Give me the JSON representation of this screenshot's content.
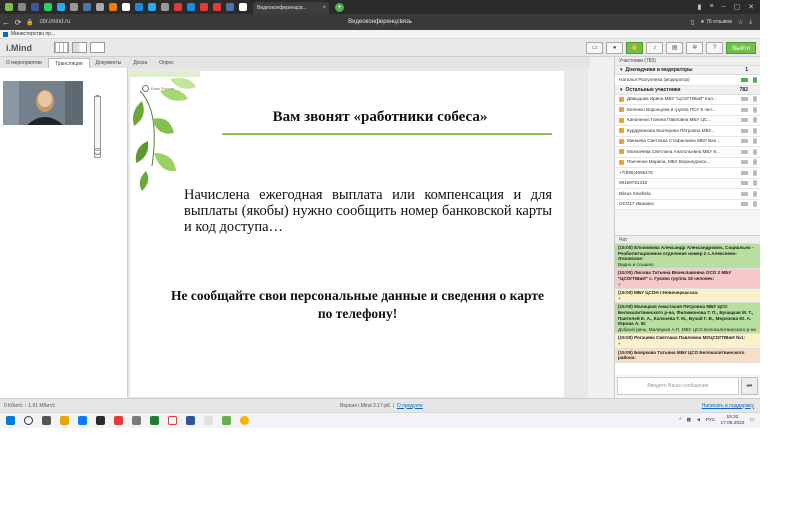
{
  "browser": {
    "active_tab_title": "Видеоконференцсв...",
    "url": "cbr.imind.ru",
    "page_title": "Видеоконференцсвязь",
    "reviews": "★ 76 отзывов",
    "bookmark": "Министерство пр..."
  },
  "app": {
    "logo": "i.Mind",
    "exit_label": "Выйти",
    "tabs": [
      {
        "label": "О мероприятии"
      },
      {
        "label": "Трансляция"
      },
      {
        "label": "Документы"
      },
      {
        "label": "Доска"
      },
      {
        "label": "Опрос"
      }
    ]
  },
  "slide": {
    "logo_text": "Банк России",
    "title": "Вам звонят «работники собеса»",
    "body": "Начислена ежегодная выплата или компенсация и для выплаты (якобы) нужно сообщить номер банковской карты и код доступа…",
    "warning": "Не сообщайте свои персональные данные и сведения о карте по телефону!"
  },
  "participants": {
    "header": "Участники (783)",
    "moderators_label": "Докладчики и модераторы",
    "moderators_count": "1",
    "moderator_name": "Наталья Разгуляева (модератор)",
    "others_label": "Остальные участники",
    "others_count": "782",
    "list": [
      {
        "name": "Давыдова Ирина МБУ \"ЦСОГПВиИ\" Кал..."
      },
      {
        "name": "Беленко Воронцова и группа ПСУ 5 чел..."
      },
      {
        "name": "Каноненко Галина Павловна МБУ ЦС..."
      },
      {
        "name": "Курдуманова Екатерина Петровна МБУ..."
      },
      {
        "name": "Минаева Светлана Стефановна МБУ Вал..."
      },
      {
        "name": "Мохначёва Светлана Анатольевна МБУ К..."
      },
      {
        "name": "Панченко Марина, МБУ Верхнедонск..."
      },
      {
        "name": "+7(995)4566470"
      },
      {
        "name": "09159791315"
      },
      {
        "name": "Bileus Sinebela"
      },
      {
        "name": "ОСО17 Иваника"
      }
    ]
  },
  "chat": {
    "header": "Чат",
    "messages": [
      {
        "head": "(15:00) Елохимова Александр Александрович, Социально - Реабилитационное отделение номер 2 с.Алексеево-Лозовское:",
        "text": "Видно и слышно"
      },
      {
        "head": "(15:00) Лисова Татьяна Вячеславовна ОСО 2 МБУ \"ЦСОГПВиИ\" с. Гуково группа 15 человек:",
        "text": "+"
      },
      {
        "head": "(15:00) МБУ ЦСОН г.Новочеркасска:",
        "text": "+"
      },
      {
        "head": "(15:00) Малицкая Анастасия Петровна МБУ ЦСО Белокалитвинского р-на, Филимонова Т. П., Бучацкая М. Т., Пантелей Е. А., Калачева Т. М., Бучай Г. В., Морозова Ю. А. Юрова А. М:",
        "text": "Добрый день, Малицкая А.П. МБУ ЦСО Белокалитвинского р-на"
      },
      {
        "head": "(15:00) Рогачева Светлана Павловна МУЦСОГПВиИ №1:",
        "text": "+"
      },
      {
        "head": "(15:00) Бояркова Татьяна МБУ ЦСО Белокалитвинского района:",
        "text": ""
      }
    ],
    "input_placeholder": "Введите Ваше сообщение"
  },
  "status": {
    "left": "0 Кбит/с  ↑  1.91 Мбит/с",
    "version": "Версия i.Mind 3.17-p6",
    "about_link": "О продукте",
    "support_link": "Написать в поддержку"
  },
  "taskbar": {
    "lang": "РУС",
    "time": "15:32",
    "date": "17.06.2022"
  }
}
